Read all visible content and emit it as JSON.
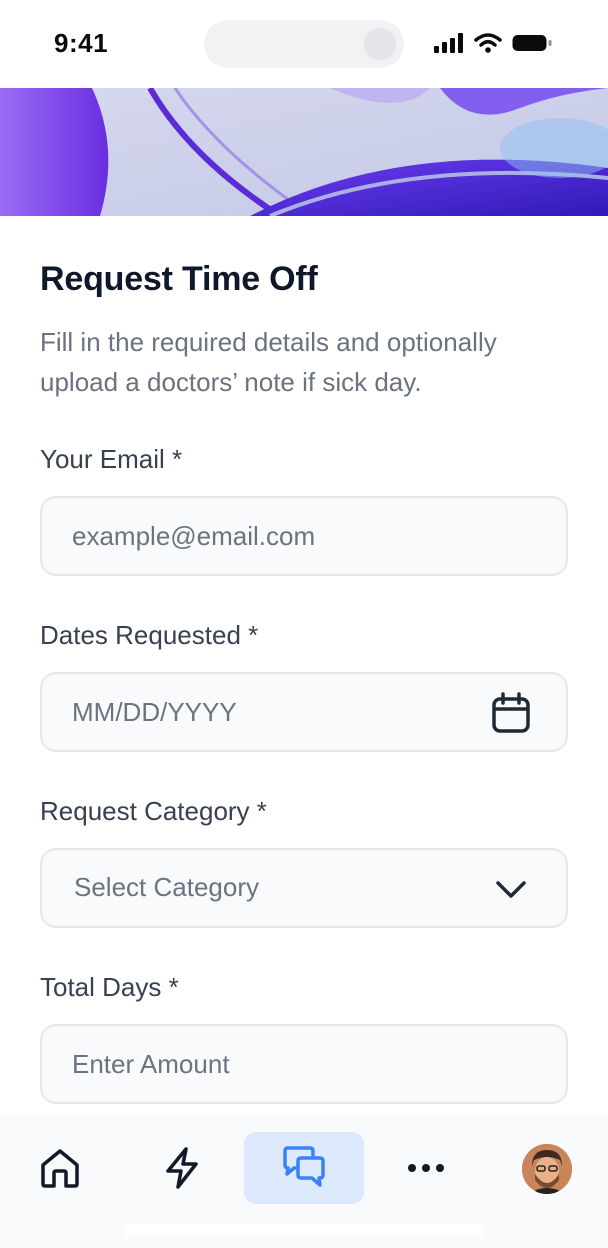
{
  "status_bar": {
    "time": "9:41",
    "icons": [
      "signal-icon",
      "wifi-icon",
      "battery-icon"
    ]
  },
  "hero": {
    "description_icon": "abstract-purple-banner"
  },
  "form": {
    "title": "Request Time Off",
    "subtitle": "Fill in the required details and optionally upload a doctors’ note if sick day.",
    "fields": {
      "email": {
        "label": "Your Email *",
        "placeholder": "example@email.com",
        "value": ""
      },
      "dates": {
        "label": "Dates Requested *",
        "placeholder": "MM/DD/YYYY",
        "value": "",
        "icon": "calendar-icon"
      },
      "category": {
        "label": "Request Category *",
        "placeholder": "Select Category",
        "selected": "",
        "icon": "chevron-down-icon"
      },
      "total_days": {
        "label": "Total Days *",
        "placeholder": "Enter Amount",
        "value": ""
      }
    }
  },
  "bottom_nav": {
    "items": [
      {
        "icon": "home-icon",
        "active": false
      },
      {
        "icon": "lightning-icon",
        "active": false
      },
      {
        "icon": "chat-icon",
        "active": true
      },
      {
        "icon": "more-icon",
        "active": false
      },
      {
        "icon": "avatar",
        "active": false
      }
    ]
  },
  "colors": {
    "accent_active_bg": "#dde9fd",
    "accent_icon": "#3b82f6",
    "field_bg": "#f9fafb",
    "field_border": "#e5e7eb",
    "text_primary": "#0f172a",
    "text_muted": "#6b7280"
  }
}
